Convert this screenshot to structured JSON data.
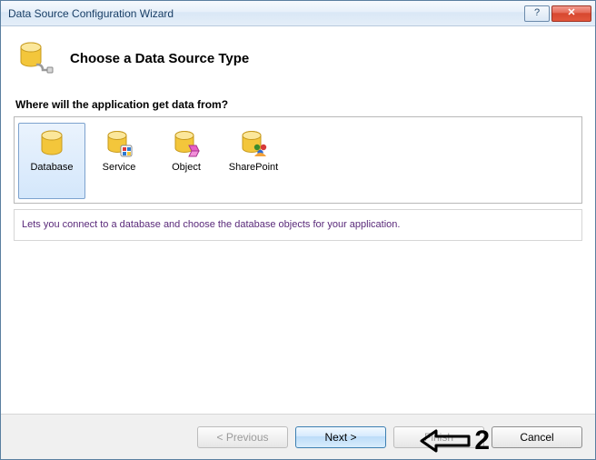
{
  "window": {
    "title": "Data Source Configuration Wizard"
  },
  "header": {
    "title": "Choose a Data Source Type"
  },
  "question": "Where will the application get data from?",
  "options": [
    {
      "label": "Database",
      "icon": "database-icon",
      "selected": true
    },
    {
      "label": "Service",
      "icon": "service-icon",
      "selected": false
    },
    {
      "label": "Object",
      "icon": "object-icon",
      "selected": false
    },
    {
      "label": "SharePoint",
      "icon": "sharepoint-icon",
      "selected": false
    }
  ],
  "description": "Lets you connect to a database and choose the database objects for your application.",
  "footer": {
    "previous": "< Previous",
    "next": "Next >",
    "finish": "Finish",
    "cancel": "Cancel"
  },
  "annotation": {
    "number": "2"
  }
}
